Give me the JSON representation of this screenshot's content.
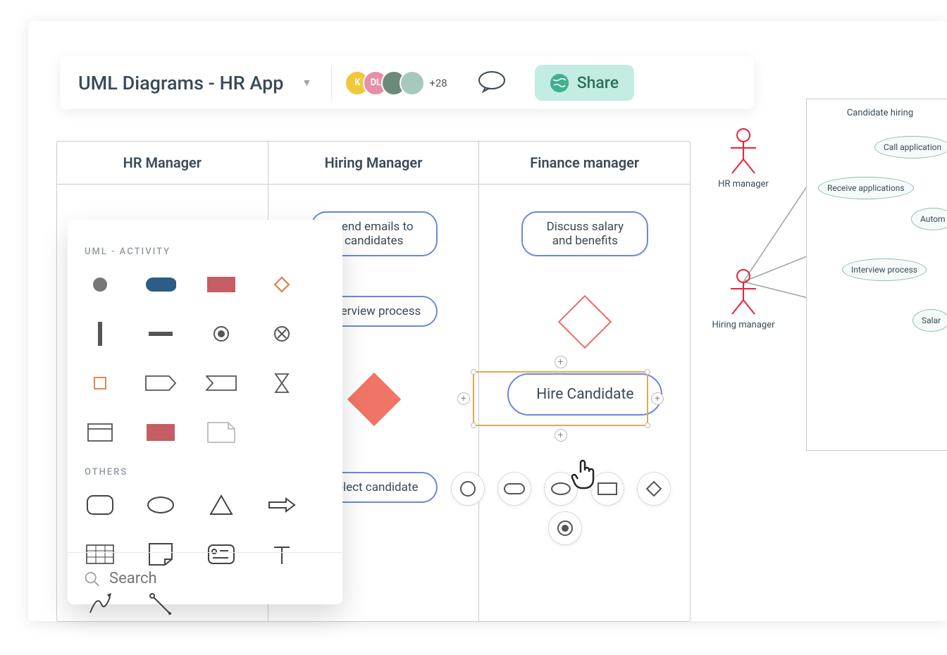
{
  "header": {
    "doc_title": "UML Diagrams - HR App",
    "avatars": {
      "a1": "K",
      "a2": "DL"
    },
    "more_count": "+28",
    "share_label": "Share"
  },
  "swimlanes": {
    "columns": [
      "HR Manager",
      "Hiring Manager",
      "Finance manager"
    ],
    "activities": {
      "send_emails": "Send emails to candidates",
      "interview": "Interview process",
      "select": "Select candidate",
      "discuss": "Discuss salary and benefits",
      "hire": "Hire Candidate"
    }
  },
  "usecase": {
    "title": "Candidate hiring",
    "actors": {
      "hr": "HR manager",
      "hiring": "Hiring manager"
    },
    "cases": {
      "call": "Call application",
      "receive": "Receive applications",
      "autom": "Autom",
      "interview": "Interview process",
      "salary": "Salar"
    }
  },
  "shapes_panel": {
    "section1": "UML - ACTIVITY",
    "section2": "OTHERS",
    "search_placeholder": "Search"
  },
  "colors": {
    "activity_border": "#6b88d8",
    "diamond_red": "#f07567",
    "share_bg": "#c3ece2",
    "share_fg": "#2f6f5e"
  }
}
